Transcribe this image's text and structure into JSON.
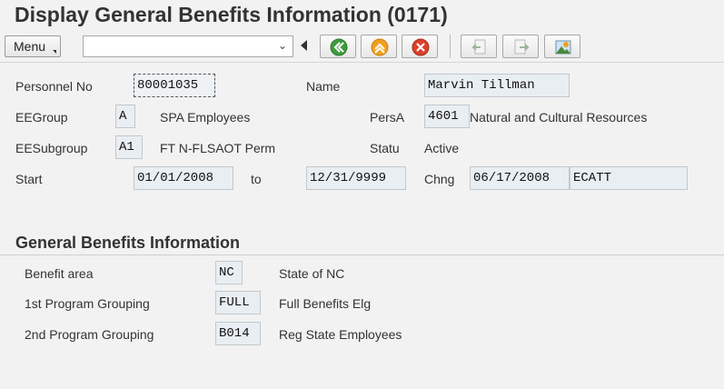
{
  "header": {
    "title": "Display General Benefits Information (0171)"
  },
  "toolbar": {
    "menu_label": "Menu",
    "command_value": "",
    "buttons": [
      "back-icon",
      "exit-icon",
      "cancel-icon",
      "previous-record-icon",
      "next-record-icon",
      "overview-icon"
    ]
  },
  "header_form": {
    "personnel_no_label": "Personnel No",
    "personnel_no": "80001035",
    "name_label": "Name",
    "name": "Marvin Tillman",
    "eegroup_label": "EEGroup",
    "eegroup_code": "A",
    "eegroup_text": "SPA Employees",
    "persa_label": "PersA",
    "persa_code": "4601",
    "persa_text": "Natural and Cultural Resources",
    "eesubgroup_label": "EESubgroup",
    "eesubgroup_code": "A1",
    "eesubgroup_text": "FT N-FLSAOT Perm",
    "status_label": "Statu",
    "status_text": "Active",
    "start_label": "Start",
    "start_date": "01/01/2008",
    "to_label": "to",
    "end_date": "12/31/9999",
    "chng_label": "Chng",
    "chng_date": "06/17/2008",
    "chng_user": "ECATT"
  },
  "benefits": {
    "section_title": "General Benefits Information",
    "rows": [
      {
        "label": "Benefit area",
        "code": "NC",
        "text": "State of NC"
      },
      {
        "label": "1st Program Grouping",
        "code": "FULL",
        "text": "Full Benefits Elg"
      },
      {
        "label": "2nd Program Grouping",
        "code": "B014",
        "text": "Reg State Employees"
      }
    ]
  }
}
